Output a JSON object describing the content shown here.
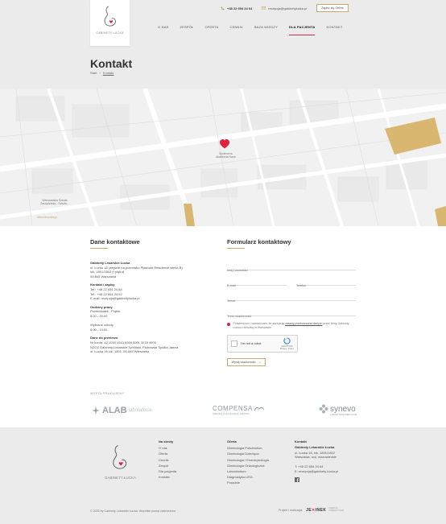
{
  "header": {
    "brand": "GABINETY ŁUCKA",
    "phone": "+48 22 654 24 64",
    "email": "recepcja@gabinetylucka.pl",
    "cta_label": "Zapisz się Online",
    "nav": [
      {
        "label": "O NAS"
      },
      {
        "label": "ZESPÓŁ"
      },
      {
        "label": "OFERTA"
      },
      {
        "label": "CENNIK"
      },
      {
        "label": "BAZA WIEDZY"
      },
      {
        "label": "DLA PACJENTA"
      },
      {
        "label": "KONTAKT"
      }
    ],
    "active_nav": "DLA PACJENTA"
  },
  "page": {
    "title": "Kontakt",
    "breadcrumb": [
      "Start",
      "Kontakt"
    ]
  },
  "map": {
    "labels": {
      "poi_main": "Społeczna\nAkademia Nauk",
      "poi_school": "Warszawska Szkoła\nZarządzania - Szkoła...",
      "street": "Marchlewskiego"
    }
  },
  "contact": {
    "title": "Dane kontaktowe",
    "company_label": "Gabinety Lekarskie Łucka",
    "address_lines": [
      "ul. Łucka 18 (wejście na przeciwko Platinum Residence wieża B)",
      "lok. 1801/1802 (I piętro)",
      "00-845 Warszawa"
    ],
    "contact_label": "Kontakt i zapisy",
    "contact_lines": [
      "Tel.: +48 22 654 24 64",
      "Tel.: +48 22 654 24 62",
      "E-mail: recepcja@gabinetylucka.pl"
    ],
    "hours_label": "Godziny pracy",
    "hours_lines": [
      "Poniedziałek - Piątek",
      "8:00 - 20:00",
      "",
      "Wybrane soboty",
      "8:00 - 14:00"
    ],
    "transfer_label": "Dane do przelewu",
    "transfer_lines": [
      "Nr konta: 42 1090 1043 0000 0001 3218 4905",
      "NZOZ Gabinety Lekarskie Tymiński, Piotrowski Spółka Jawna",
      "ul. Łucka 18 lok. 1801, 00-845 Warszawa"
    ]
  },
  "form": {
    "title": "Formularz kontaktowy",
    "name_placeholder": "Imię i nazwisko",
    "email_placeholder": "E-mail",
    "phone_placeholder": "Telefon",
    "subject_placeholder": "Temat",
    "message_placeholder": "Treść wiadomości",
    "consent_text_1": "Potwierdzam i oświadczam, że akceptuję ",
    "consent_link": "zasady przetwarzania danych",
    "consent_text_2": " przez firmę Gabinety Łucka z siedzibą w Warszawie.",
    "captcha_label": "I'm not a robot",
    "captcha_brand": "reCAPTCHA",
    "captcha_sub": "Privacy - Terms",
    "submit_label": "Wyślij wiadomość"
  },
  "partners": {
    "label": "WSPÓŁPRACUJEMY",
    "alab": "ALAB",
    "alab_sub": "laboratoria",
    "compensa": "COMPENSA",
    "compensa_sub": "VIENNA INSURANCE GROUP",
    "synevo": "synevo",
    "synevo_sub": "LABORATORIA MEDYCZNE"
  },
  "footer": {
    "brand": "GABINETY ŁUCKA",
    "col1": {
      "title": "Na skróty",
      "links": [
        "O nas",
        "Oferta",
        "Cennik",
        "Zespół",
        "Dla pacjenta",
        "Kontakt"
      ]
    },
    "col2": {
      "title": "Oferta",
      "links": [
        "Ginekologia Położnictwo",
        "Ginekologia Dziecięca",
        "Ginekologia i Endokrynologia",
        "Ginekologia Onkologiczna",
        "Laboratorium",
        "Diagnostyka USG",
        "Poradnie"
      ]
    },
    "col3": {
      "title": "Kontakt",
      "company": "Gabinety Lekarskie Łucka",
      "address_1": "ul. Łucka 18, lok. 1801/1802",
      "address_2": "Warszawa, woj. mazowieckie",
      "phone": "T: +48 22 654 24 64",
      "email": "E: recepcja@gabinety-lucka.pl"
    },
    "copyright": "© 2020 by Gabinety Lekarskie Łucka. Wszelkie prawa zastrzeżone",
    "realization_label": "Projekt i realizacja:",
    "agency_a": "JE",
    "agency_b": "INEK",
    "agency_tag": "AGENCJA\nINTERAKTYWNA"
  },
  "colors": {
    "accent": "#d6264a",
    "gold": "#c9a96e",
    "header_bg": "#ebebeb"
  }
}
